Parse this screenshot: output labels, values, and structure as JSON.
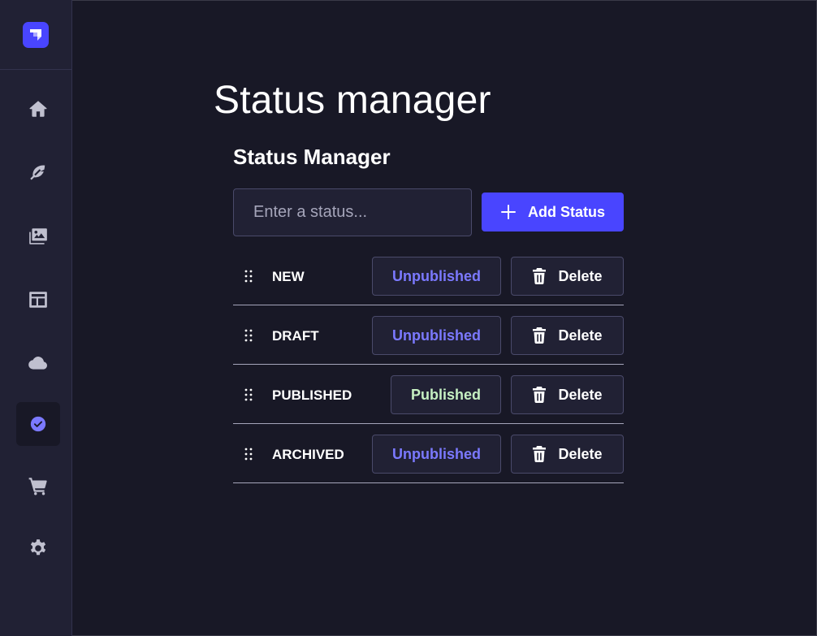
{
  "page": {
    "title": "Status manager"
  },
  "manager": {
    "section_title": "Status Manager",
    "input": {
      "placeholder": "Enter a status...",
      "value": ""
    },
    "add_button_label": "Add Status",
    "delete_label": "Delete",
    "statuses": [
      {
        "name": "NEW",
        "state_label": "Unpublished",
        "published": false
      },
      {
        "name": "DRAFT",
        "state_label": "Unpublished",
        "published": false
      },
      {
        "name": "PUBLISHED",
        "state_label": "Published",
        "published": true
      },
      {
        "name": "ARCHIVED",
        "state_label": "Unpublished",
        "published": false
      }
    ]
  },
  "sidebar": {
    "items": [
      {
        "icon": "home-icon"
      },
      {
        "icon": "feather-icon"
      },
      {
        "icon": "media-library-icon"
      },
      {
        "icon": "layout-icon"
      },
      {
        "icon": "cloud-icon"
      },
      {
        "icon": "check-circle-icon",
        "active": true
      },
      {
        "icon": "cart-icon"
      },
      {
        "icon": "gear-icon"
      }
    ]
  },
  "colors": {
    "accent": "#4945ff",
    "background": "#181826",
    "panel": "#212134",
    "unpublished_text": "#7b79ff",
    "published_text": "#c6f0c2"
  }
}
